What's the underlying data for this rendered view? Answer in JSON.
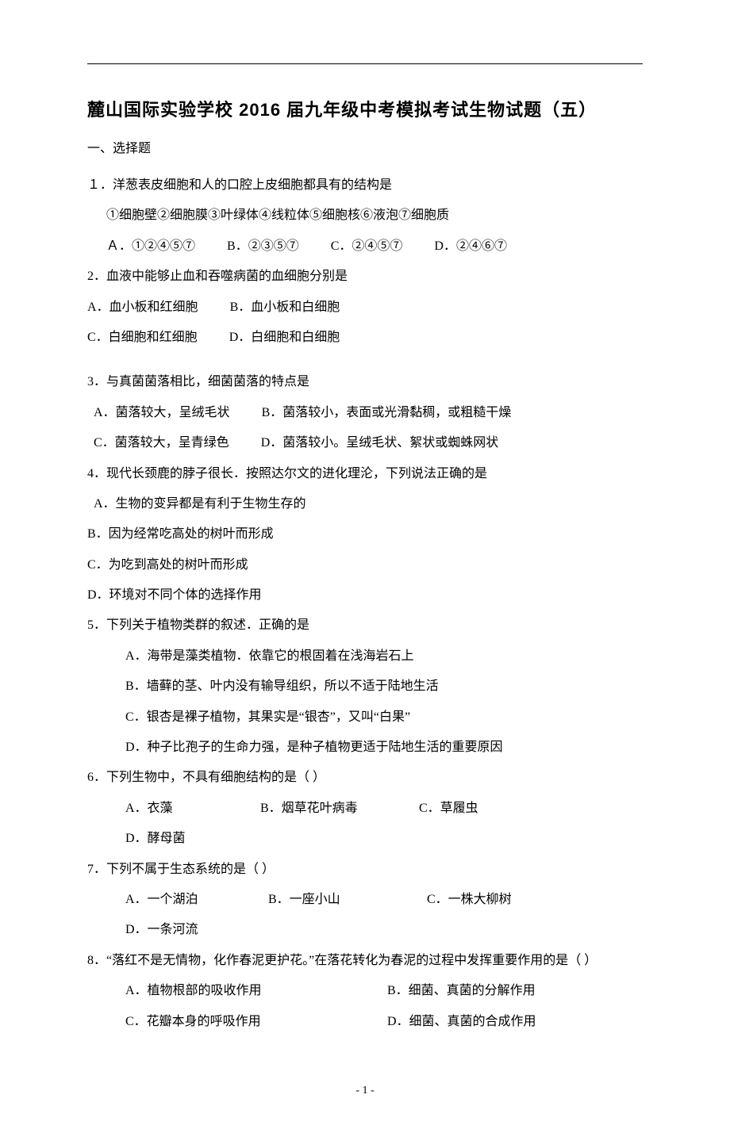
{
  "title": "麓山国际实验学校 2016 届九年级中考模拟考试生物试题（五）",
  "section1": "一、选择题",
  "q1": {
    "stem": "１．洋葱表皮细胞和人的口腔上皮细胞都具有的结构是",
    "sub": "①细胞壁②细胞膜③叶绿体④线粒体⑤细胞核⑥液泡⑦细胞质",
    "A": "Ａ．①②④⑤⑦",
    "B": "B．②③⑤⑦",
    "C": "C．②④⑤⑦",
    "D": "D．②④⑥⑦"
  },
  "q2": {
    "stem": "2．血液中能够止血和吞噬病菌的血细胞分别是",
    "A": "A．血小板和红细胞",
    "B": "B．血小板和白细胞",
    "C": "C．白细胞和红细胞",
    "D": "D．白细胞和白细胞"
  },
  "q3": {
    "stem": "3．与真菌菌落相比，细菌菌落的特点是",
    "A": "A．菌落较大，呈绒毛状",
    "B": "B．菌落较小，表面或光滑黏稠，或粗糙干燥",
    "C": "C．菌落较大，呈青绿色",
    "D": "D．菌落较小。呈绒毛状、絮状或蜘蛛网状"
  },
  "q4": {
    "stem": "4．现代长颈鹿的脖子很长．按照达尔文的进化理沦，下列说法正确的是",
    "A": "A．生物的变异都是有利于生物生存的",
    "B": "B．因为经常吃高处的树叶而形成",
    "C": "C．为吃到高处的树叶而形成",
    "D": "D．环境对不同个体的选择作用"
  },
  "q5": {
    "stem": "5．下列关于植物类群的叙述．正确的是",
    "A": "A．海带是藻类植物．依靠它的根固着在浅海岩石上",
    "B": "B．墙藓的茎、叶内没有输导组织，所以不适于陆地生活",
    "C": "C．银杏是裸子植物，其果实是“银杏”，又叫“白果”",
    "D": "D．种子比孢子的生命力强，是种子植物更适于陆地生活的重要原因"
  },
  "q6": {
    "stem": "6．下列生物中，不具有细胞结构的是（    ）",
    "A": "A．衣藻",
    "B": "B．烟草花叶病毒",
    "C": "C．草履虫",
    "D": "D．酵母菌"
  },
  "q7": {
    "stem": "7．下列不属于生态系统的是（    ）",
    "A": "A．一个湖泊",
    "B": "B．一座小山",
    "C": "C．一株大柳树",
    "D": "D．一条河流"
  },
  "q8": {
    "stem": "8．“落红不是无情物，化作春泥更护花。”在落花转化为春泥的过程中发挥重要作用的是（    ）",
    "A": "A．植物根部的吸收作用",
    "B": "B．细菌、真菌的分解作用",
    "C": "C．花瓣本身的呼吸作用",
    "D": "D．细菌、真菌的合成作用"
  },
  "footer": {
    "page": "- 1 -"
  }
}
